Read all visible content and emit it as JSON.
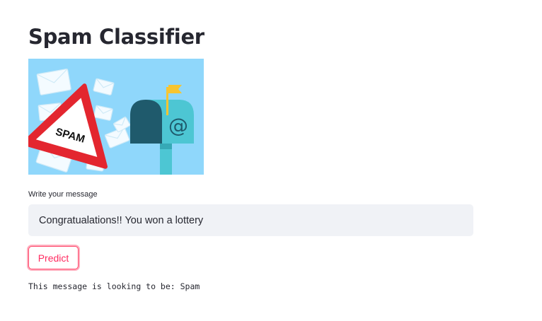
{
  "page": {
    "title": "Spam Classifier"
  },
  "hero_image": {
    "badge_text": "SPAM",
    "mailbox_symbol": "@",
    "colors": {
      "background": "#8fd7fb",
      "triangle_border": "#e3262f",
      "mailbox_dark": "#1f5a6c",
      "mailbox_light": "#4dc6d3",
      "flag": "#f7c531"
    }
  },
  "message_field": {
    "label": "Write your message",
    "value": "Congratualations!! You won a lottery"
  },
  "predict_button": {
    "label": "Predict"
  },
  "result": {
    "text": "This message is looking to be: Spam"
  },
  "colors": {
    "accent": "#ff4b6e",
    "input_background": "#f0f2f6",
    "text": "#262730"
  }
}
